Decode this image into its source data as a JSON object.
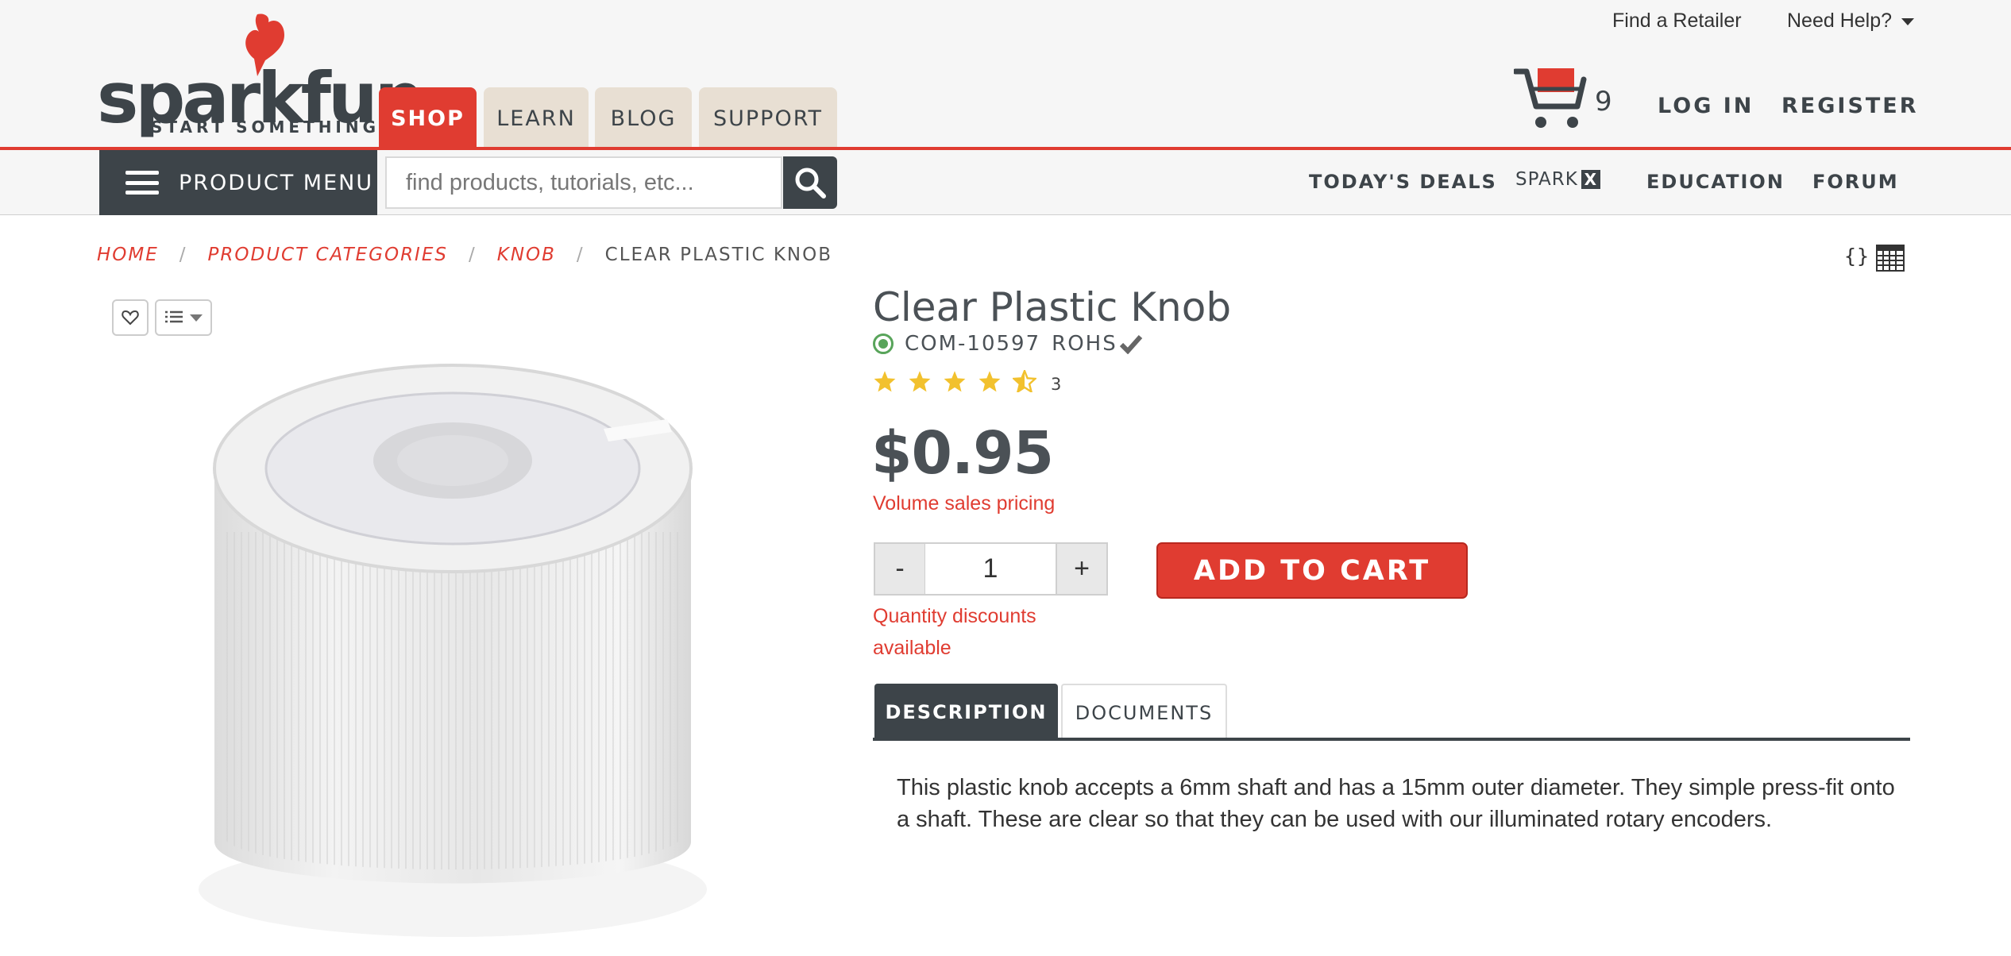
{
  "header": {
    "logo_text": "sparkfun",
    "logo_tagline": "START SOMETHING",
    "tabs": [
      {
        "label": "SHOP"
      },
      {
        "label": "LEARN"
      },
      {
        "label": "BLOG"
      },
      {
        "label": "SUPPORT"
      }
    ],
    "utility_links": {
      "find_retailer": "Find a Retailer",
      "need_help": "Need Help?"
    },
    "cart_count": "9",
    "login": "LOG IN",
    "register": "REGISTER"
  },
  "nav": {
    "product_menu": "PRODUCT MENU",
    "search_placeholder": "find products, tutorials, etc...",
    "links": {
      "todays_deals": "TODAY'S DEALS",
      "sparkx": "SPARK",
      "sparkx_badge": "X",
      "education": "EDUCATION",
      "forum": "FORUM"
    }
  },
  "breadcrumb": [
    {
      "label": "HOME"
    },
    {
      "label": "PRODUCT CATEGORIES"
    },
    {
      "label": "KNOB"
    },
    {
      "label": "CLEAR PLASTIC KNOB"
    }
  ],
  "breadcrumb_separator": "/",
  "json_icon_text": "{}",
  "product": {
    "title": "Clear Plastic Knob",
    "sku": "COM-10597",
    "rohs": "ROHS",
    "rating_stars": 4.5,
    "review_count": "3",
    "price": "$0.95",
    "volume_pricing": "Volume sales pricing",
    "qty_minus": "-",
    "quantity": "1",
    "qty_plus": "+",
    "add_to_cart": "ADD TO CART",
    "qty_discount": "Quantity discounts available",
    "tabs": [
      {
        "label": "DESCRIPTION"
      },
      {
        "label": "DOCUMENTS"
      }
    ],
    "description": "This plastic knob accepts a 6mm shaft and has a 15mm outer diameter. They simple press-fit onto a shaft. These are clear so that they can be used with our illuminated rotary encoders."
  },
  "colors": {
    "brand_red": "#e03c31",
    "dark_slate": "#3d4449",
    "tab_beige": "#e8dfd3",
    "star_yellow": "#f2c12e",
    "stock_green": "#58a45a"
  },
  "icons": [
    "flame-logo-icon",
    "cart-icon",
    "hamburger-icon",
    "search-icon",
    "calendar-icon",
    "heart-icon",
    "list-icon",
    "status-dot-icon",
    "check-icon",
    "star-icon"
  ]
}
